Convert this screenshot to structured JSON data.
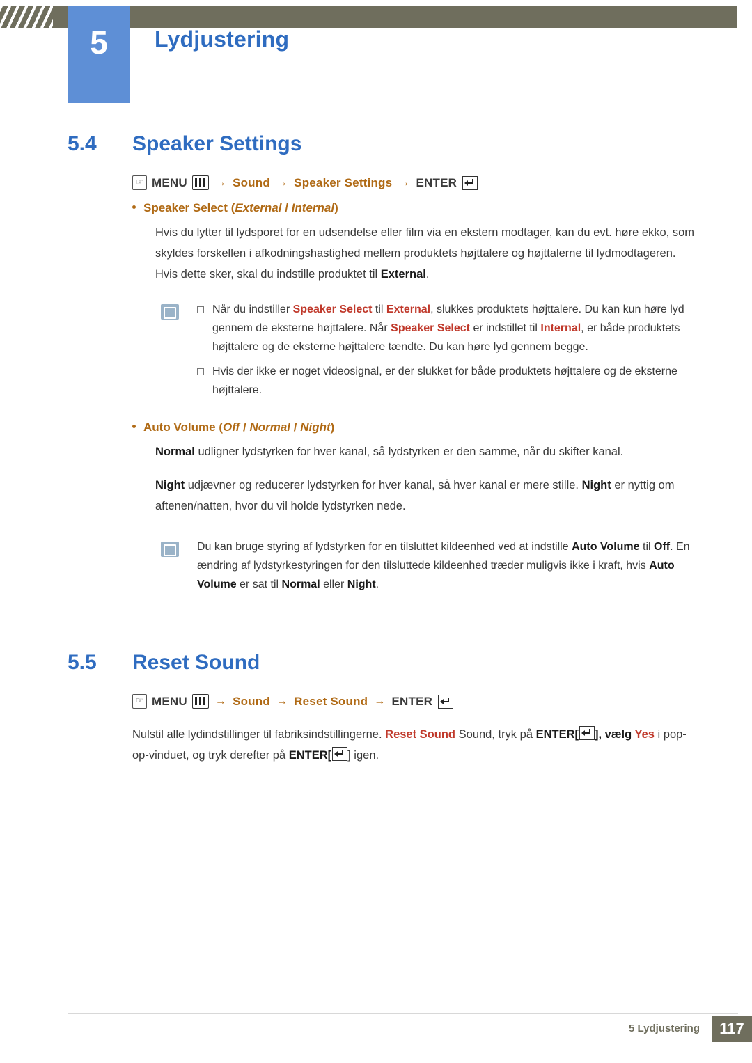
{
  "header": {
    "chapter_number": "5",
    "chapter_title": "Lydjustering"
  },
  "sections": [
    {
      "number": "5.4",
      "title": "Speaker Settings"
    },
    {
      "number": "5.5",
      "title": "Reset Sound"
    }
  ],
  "menu_path_1": {
    "hand_icon": "hand-icon",
    "menu_label": "MENU",
    "menu_icon": "menu-bars-icon",
    "arrow": "→",
    "item1": "Sound",
    "item2": "Speaker Settings",
    "enter_label": "ENTER",
    "enter_icon": "enter-key-icon"
  },
  "menu_path_2": {
    "hand_icon": "hand-icon",
    "menu_label": "MENU",
    "menu_icon": "menu-bars-icon",
    "arrow": "→",
    "item1": "Sound",
    "item2": "Reset Sound",
    "enter_label": "ENTER",
    "enter_icon": "enter-key-icon"
  },
  "speaker_select": {
    "label": "Speaker Select",
    "open_paren": "(",
    "option1": "External",
    "slash": "/",
    "option2": "Internal",
    "close_paren": ")",
    "paragraph_1_a": "Hvis du lytter til lydsporet for en udsendelse eller film via en ekstern modtager, kan du evt. høre ekko, som skyldes forskellen i afkodningshastighed mellem produktets højttalere og højttalerne til lydmodtageren. Hvis dette sker, skal du indstille produktet til ",
    "paragraph_1_kw": "External",
    "paragraph_1_b": ".",
    "note_1_a": "Når du indstiller ",
    "note_1_kw1": "Speaker Select",
    "note_1_b": " til ",
    "note_1_kw2": "External",
    "note_1_c": ", slukkes produktets højttalere. Du kan kun høre lyd gennem de eksterne højttalere. Når ",
    "note_1_kw3": "Speaker Select",
    "note_1_d": " er indstillet til ",
    "note_1_kw4": "Internal",
    "note_1_e": ", er både produktets højttalere og de eksterne højttalere tændte. Du kan høre lyd gennem begge.",
    "note_2": "Hvis der ikke er noget videosignal, er der slukket for både produktets højttalere og de eksterne højttalere."
  },
  "auto_volume": {
    "label": "Auto Volume",
    "open_paren": "(",
    "option1": "Off",
    "slash1": "/",
    "option2": "Normal",
    "slash2": "/",
    "option3": "Night",
    "close_paren": ")",
    "para1_kw1": "Normal",
    "para1_rest": " udligner lydstyrken for hver kanal, så lydstyrken er den samme, når du skifter kanal.",
    "para2_kw1": "Night",
    "para2_a": " udjævner og reducerer lydstyrken for hver kanal, så hver kanal er mere stille. ",
    "para2_kw2": "Night",
    "para2_b": " er nyttig om aftenen/natten, hvor du vil holde lydstyrken nede.",
    "note_a": "Du kan bruge styring af lydstyrken for en tilsluttet kildeenhed ved at indstille ",
    "note_kw1": "Auto Volume",
    "note_b": " til ",
    "note_kw2": "Off",
    "note_c": ". En ændring af lydstyrkestyringen for den tilsluttede kildeenhed træder muligvis ikke i kraft, hvis ",
    "note_kw3": "Auto Volume",
    "note_d": " er sat til ",
    "note_kw4": "Normal",
    "note_e": " eller ",
    "note_kw5": "Night",
    "note_f": "."
  },
  "reset_sound": {
    "para_a": "Nulstil alle lydindstillinger til fabriksindstillingerne. ",
    "para_kw1": "Reset Sound",
    "para_b": " Sound, tryk på ",
    "para_kw2": "ENTER",
    "para_c": "[",
    "para_d": "], vælg ",
    "para_kw3": "Yes",
    "para_e": " i pop-op-vinduet, og tryk derefter på ",
    "para_kw4": "ENTER",
    "para_f": "[",
    "para_g": "] igen."
  },
  "footer": {
    "label": "5 Lydjustering",
    "page": "117"
  }
}
